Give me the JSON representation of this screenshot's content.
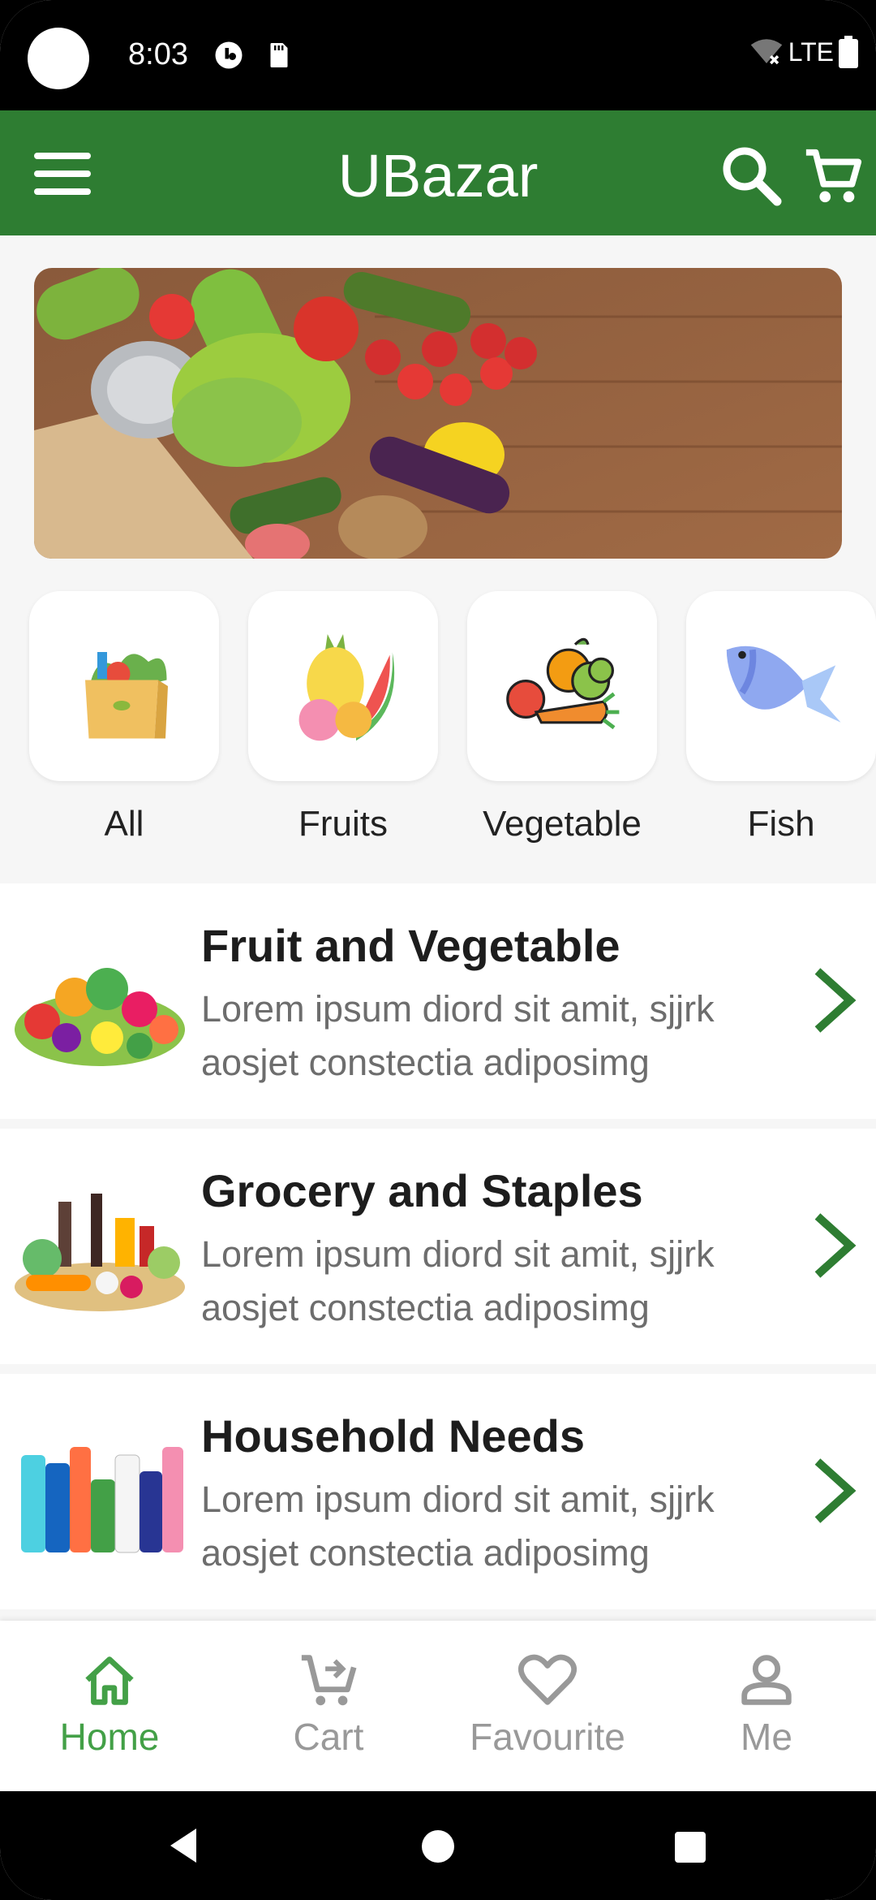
{
  "status_bar": {
    "time": "8:03",
    "network": "LTE"
  },
  "app_bar": {
    "title": "UBazar"
  },
  "categories": [
    {
      "label": "All",
      "icon": "grocery-bag-icon"
    },
    {
      "label": "Fruits",
      "icon": "fruits-icon"
    },
    {
      "label": "Vegetable",
      "icon": "vegetables-icon"
    },
    {
      "label": "Fish",
      "icon": "fish-icon"
    }
  ],
  "list": [
    {
      "title": "Fruit and Vegetable",
      "desc": "Lorem ipsum diord sit amit, sjjrk aosjet constectia adiposimg"
    },
    {
      "title": "Grocery and Staples",
      "desc": "Lorem ipsum diord sit amit, sjjrk aosjet constectia adiposimg"
    },
    {
      "title": "Household Needs",
      "desc": "Lorem ipsum diord sit amit, sjjrk aosjet constectia adiposimg"
    }
  ],
  "bottom_nav": [
    {
      "label": "Home",
      "active": true
    },
    {
      "label": "Cart",
      "active": false
    },
    {
      "label": "Favourite",
      "active": false
    },
    {
      "label": "Me",
      "active": false
    }
  ],
  "colors": {
    "primary": "#2e7d32",
    "active": "#43a047",
    "inactive": "#999999"
  }
}
